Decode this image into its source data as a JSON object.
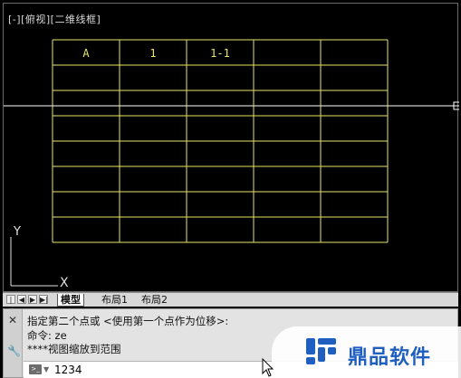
{
  "viewport": {
    "label_parts": [
      "[-]",
      "[俯视]",
      "[二维线框]"
    ]
  },
  "table": {
    "header": [
      "A",
      "1",
      "1-1",
      "",
      ""
    ],
    "rows": 8,
    "cols": 5,
    "line_color": "#e8e46c"
  },
  "ucs": {
    "y_label": "Y",
    "x_label": "X"
  },
  "layout_tabs": {
    "nav": [
      "|◀",
      "◀",
      "▶",
      "▶|"
    ],
    "tabs": [
      "模型",
      "布局1",
      "布局2"
    ],
    "active": "模型"
  },
  "command": {
    "history": [
      "指定第二个点或 <使用第一个点作为位移>:",
      "命令: ze",
      " ****视图缩放到范围"
    ],
    "input_value": "1234",
    "left_icons": [
      "close-icon",
      "wrench-icon"
    ]
  },
  "watermark": {
    "text": "鼎品软件"
  }
}
